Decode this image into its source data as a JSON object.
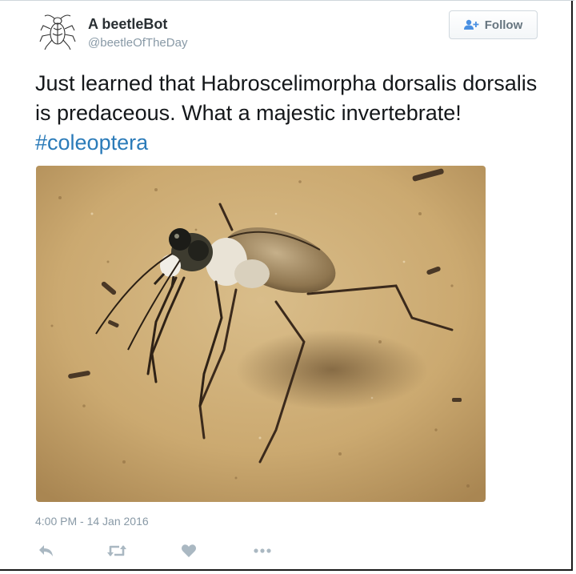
{
  "user": {
    "display_name": "A beetleBot",
    "handle": "@beetleOfTheDay",
    "avatar_icon": "beetle-drawing-icon"
  },
  "follow_button": {
    "label": "Follow",
    "icon": "add-user-icon"
  },
  "tweet": {
    "text": "Just learned that Habroscelimorpha dorsalis dorsalis is predaceous. What a majestic invertebrate! ",
    "hashtag": "#coleoptera",
    "timestamp": "4:00 PM - 14 Jan 2016"
  },
  "media": {
    "subject": "photo-tiger-beetle-on-sand"
  },
  "actions": [
    {
      "name": "reply-icon"
    },
    {
      "name": "retweet-icon"
    },
    {
      "name": "like-icon"
    },
    {
      "name": "more-icon"
    }
  ],
  "colors": {
    "link": "#2b7bb9",
    "muted": "#8899a6",
    "text": "#14171a",
    "action_icon": "#aab8c2"
  }
}
